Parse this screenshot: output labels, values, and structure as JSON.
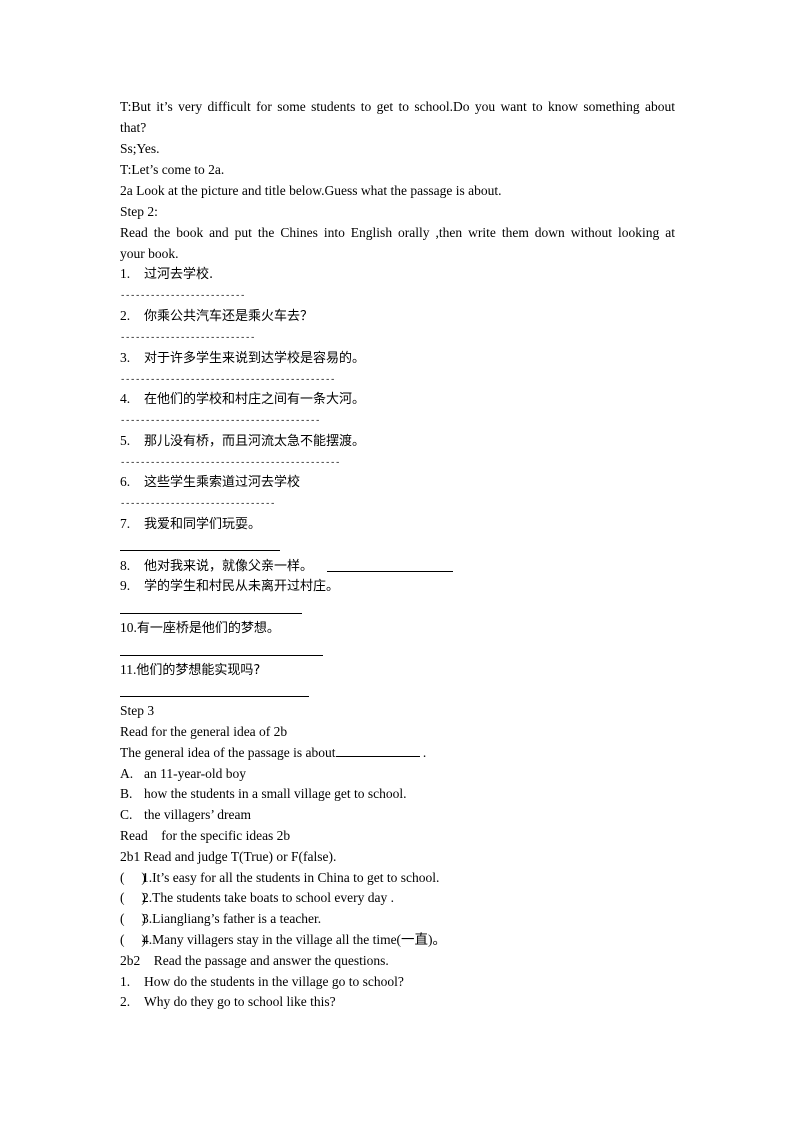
{
  "intro": {
    "line1": "T:But it’s very difficult for some students to get to school.Do you want to know something about",
    "line1b": "that?",
    "line2": "Ss;Yes.",
    "line3": "T:Let’s come to 2a.",
    "line4": "2a Look at the picture and title below.Guess what the passage is about."
  },
  "step2": {
    "heading": "Step 2:",
    "instruction": "Read the book and put the Chines into English orally ,then write them down without looking at",
    "instruction_b": "your book.",
    "items": [
      {
        "num": "1.",
        "text": "过河去学校.",
        "dashes": "-------------------------"
      },
      {
        "num": "2.",
        "text": "你乘公共汽车还是乘火车去？",
        "dashes": "---------------------------"
      },
      {
        "num": "3.",
        "text": "对于许多学生来说到达学校是容易的。",
        "dashes": "-------------------------------------------"
      },
      {
        "num": "4.",
        "text": "在他们的学校和村庄之间有一条大河。",
        "dashes": "----------------------------------------"
      },
      {
        "num": "5.",
        "text": "那儿没有桥，而且河流太急不能摆渡。",
        "dashes": "--------------------------------------------"
      },
      {
        "num": "6.",
        "text": "这些学生乘索道过河去学校",
        "dashes": "-------------------------------"
      },
      {
        "num": "7.",
        "text": "我爱和同学们玩耍。"
      },
      {
        "num": "8.",
        "text": "他对我来说，就像父亲一样。"
      },
      {
        "num": "9.",
        "text": "学的学生和村民从未离开过村庄。"
      },
      {
        "num": "10.",
        "text": "有一座桥是他们的梦想。"
      },
      {
        "num": "11.",
        "text": "他们的梦想能实现吗?"
      }
    ]
  },
  "step3": {
    "heading": "Step 3",
    "general_heading": "Read for the general idea of 2b",
    "question": "The general idea of the passage is about",
    "question_end": " .",
    "options": [
      {
        "label": "A.",
        "text": "an 11-year-old boy"
      },
      {
        "label": "B.",
        "text": "how the students in a small village get to school."
      },
      {
        "label": "C.",
        "text": "the villagers’ dream"
      }
    ],
    "specific_heading": "Read    for the specific ideas 2b",
    "tf_heading": "2b1 Read and judge T(True) or F(false).",
    "tf_items": [
      {
        "paren": "(     )",
        "text": "1.It’s easy for all the students in China to get to school."
      },
      {
        "paren": "(     )",
        "text": "2.The students take boats to school every day ."
      },
      {
        "paren": "(     )",
        "text": "3.Liangliang’s father is a teacher."
      },
      {
        "paren": "(     )",
        "text": "4.Many villagers stay in the village all the time(一直)。"
      }
    ],
    "qa_heading": "2b2    Read the passage and answer the questions.",
    "questions": [
      {
        "num": "1.",
        "text": "How do the students in the village go to school?"
      },
      {
        "num": "2.",
        "text": "Why do they go to school like this?"
      }
    ]
  }
}
